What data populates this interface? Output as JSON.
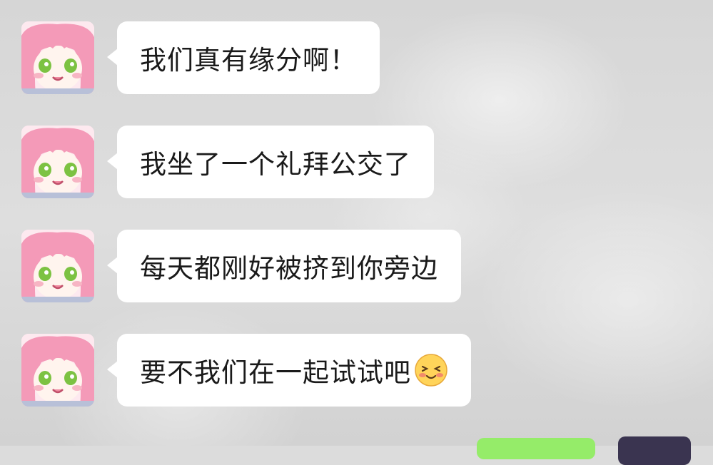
{
  "chat": {
    "messages": [
      {
        "sender": "other",
        "text": "我们真有缘分啊！"
      },
      {
        "sender": "other",
        "text": "我坐了一个礼拜公交了"
      },
      {
        "sender": "other",
        "text": "每天都刚好被挤到你旁边"
      },
      {
        "sender": "other",
        "text": "要不我们在一起试试吧",
        "emoji": "blushing-smile-emoji"
      }
    ]
  },
  "colors": {
    "bubble_other": "#ffffff",
    "bubble_self": "#95ec69",
    "background": "#dcdcdc",
    "avatar_hair": "#f48fb1",
    "avatar_eyes": "#7cc242"
  },
  "icons": {
    "avatar": "anime-girl-avatar",
    "emoji": "blushing-smile-emoji"
  }
}
